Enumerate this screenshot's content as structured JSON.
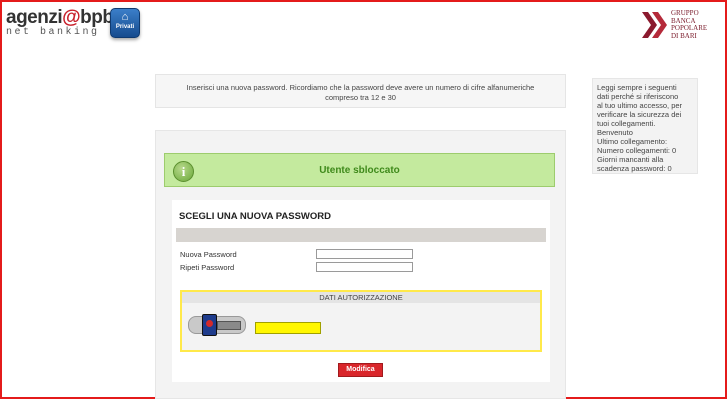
{
  "header": {
    "logo_brand": "agenzi",
    "logo_at": "@",
    "logo_bpb": "bpb",
    "logo_sub": "net banking",
    "privati_label": "Privati",
    "bank_name_lines": [
      "GRUPPO",
      "BANCA",
      "POPOLARE",
      "DI BARI"
    ]
  },
  "instructions": {
    "line1": "Inserisci una nuova password. Ricordiamo che la password deve avere un numero di cifre alfanumeriche",
    "line2": "compreso tra 12 e 30"
  },
  "sidebar": {
    "lines": [
      "Leggi sempre i seguenti",
      "dati perché si riferiscono",
      "al tuo ultimo accesso, per",
      "verificare la sicurezza dei",
      "tuoi collegamenti.",
      "Benvenuto",
      "Ultimo collegamento:",
      "Numero collegamenti: 0",
      "Giorni mancanti alla",
      "scadenza password: 0"
    ]
  },
  "status": {
    "message": "Utente sbloccato",
    "icon": "info-icon",
    "icon_glyph": "i"
  },
  "form": {
    "title": "SCEGLI UNA NUOVA PASSWORD",
    "new_password_label": "Nuova Password",
    "new_password_value": "",
    "repeat_password_label": "Ripeti Password",
    "repeat_password_value": "",
    "auth_header": "DATI AUTORIZZAZIONE",
    "otp_value": "",
    "submit_label": "Modifica"
  },
  "colors": {
    "frame": "#e41b1b",
    "status_bg": "#c4ea9e",
    "status_text": "#3f8a1b",
    "auth_border": "#ffe94a",
    "otp_bg": "#fff700",
    "button_bg": "#d9262b"
  }
}
